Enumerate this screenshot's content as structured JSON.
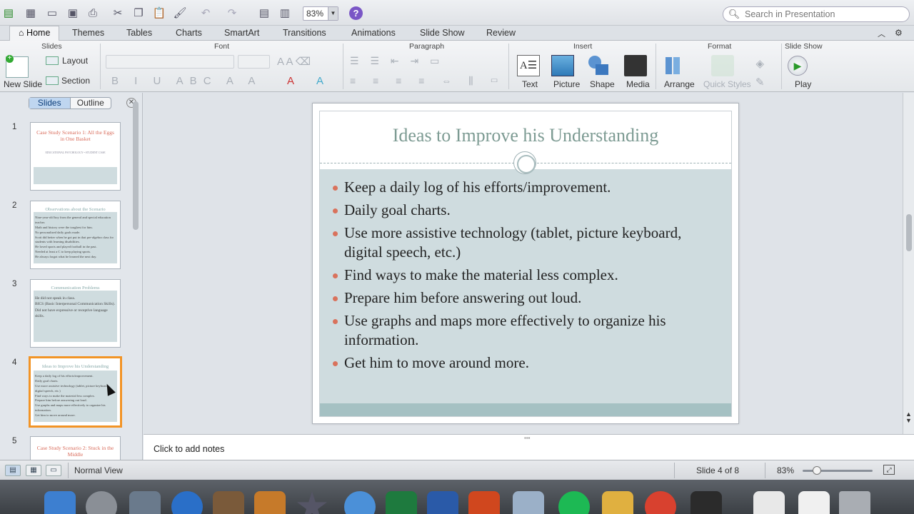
{
  "toolbar": {
    "zoom_value": "83%",
    "search_placeholder": "Search in Presentation",
    "help_label": "?"
  },
  "ribbon_tabs": [
    "Home",
    "Themes",
    "Tables",
    "Charts",
    "SmartArt",
    "Transitions",
    "Animations",
    "Slide Show",
    "Review"
  ],
  "ribbon": {
    "groups": {
      "slides": "Slides",
      "font": "Font",
      "paragraph": "Paragraph",
      "insert": "Insert",
      "format": "Format",
      "slideshow": "Slide Show"
    },
    "new_slide": "New Slide",
    "layout": "Layout",
    "section": "Section",
    "insert_items": [
      "Text",
      "Picture",
      "Shape",
      "Media"
    ],
    "arrange": "Arrange",
    "quick_styles": "Quick Styles",
    "play": "Play"
  },
  "sidebar": {
    "seg_slides": "Slides",
    "seg_outline": "Outline",
    "close": "✕",
    "thumbs": [
      {
        "num": "1",
        "title": "Case Study Scenario 1: All the Eggs in One Basket",
        "sub": "EDUCATIONAL PSYCHOLOGY • STUDENT CASE"
      },
      {
        "num": "2",
        "title": "Observations about the Scenario",
        "lines": [
          "Nine-year-old boy from the general and special education teacher.",
          "Math and history were the toughest for him.",
          "No personalized daily goals made.",
          "Scott did better when he got put in that pre-algebra class for students with learning disabilities.",
          "He loved sports and played football in the past.",
          "Needed at least a C to keep playing sports.",
          "He always forgot what he learned the next day."
        ]
      },
      {
        "num": "3",
        "title": "Communication Problems",
        "lines": [
          "He did not speak in class.",
          "BICS (Basic Interpersonal Communication Skills).",
          "Did not have expressive or receptive language skills."
        ]
      },
      {
        "num": "4",
        "title": "Ideas to Improve his Understanding",
        "lines": [
          "Keep a daily log of his efforts/improvement.",
          "Daily goal charts.",
          "Use more assistive technology (tablet, picture keyboard, digital speech, etc.)",
          "Find ways to make the material less complex.",
          "Prepare him before answering out loud.",
          "Use graphs and maps more effectively to organize his information.",
          "Get him to move around more."
        ]
      },
      {
        "num": "5",
        "title": "Case Study Scenario 2: Stuck in the Middle"
      }
    ]
  },
  "slide": {
    "title": "Ideas to Improve his Understanding",
    "bullets": [
      "Keep a daily log of his efforts/improvement.",
      "Daily goal charts.",
      "Use more assistive technology (tablet, picture keyboard, digital speech, etc.)",
      "Find ways to make the material less complex.",
      "Prepare him before answering out loud.",
      "Use graphs and maps more effectively to organize his information.",
      "Get him to move around more."
    ]
  },
  "notes_placeholder": "Click to add notes",
  "status": {
    "view": "Normal View",
    "slide_counter": "Slide 4 of 8",
    "zoom": "83%",
    "zoom_level_fraction": 0.2
  },
  "colors": {
    "slide_title": "#7d9b93",
    "bullet": "#d9725c",
    "slide_band": "#cfdcdf",
    "selection": "#f29426"
  }
}
